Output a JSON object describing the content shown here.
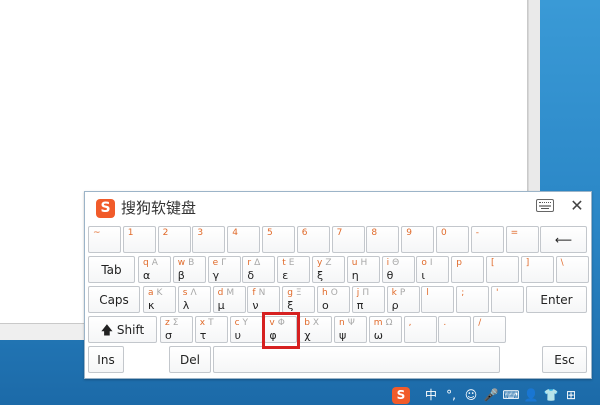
{
  "window": {
    "title": "搜狗软键盘",
    "logo_letter": "S"
  },
  "rows": [
    [
      {
        "top": "~",
        "up": "",
        "main": ""
      },
      {
        "top": "1",
        "up": "",
        "main": ""
      },
      {
        "top": "2",
        "up": "",
        "main": ""
      },
      {
        "top": "3",
        "up": "",
        "main": ""
      },
      {
        "top": "4",
        "up": "",
        "main": ""
      },
      {
        "top": "5",
        "up": "",
        "main": ""
      },
      {
        "top": "6",
        "up": "",
        "main": ""
      },
      {
        "top": "7",
        "up": "",
        "main": ""
      },
      {
        "top": "8",
        "up": "",
        "main": ""
      },
      {
        "top": "9",
        "up": "",
        "main": ""
      },
      {
        "top": "0",
        "up": "",
        "main": ""
      },
      {
        "top": "-",
        "up": "",
        "main": ""
      },
      {
        "top": "=",
        "up": "",
        "main": ""
      }
    ],
    [
      {
        "top": "q",
        "up": "A",
        "main": "α"
      },
      {
        "top": "w",
        "up": "B",
        "main": "β"
      },
      {
        "top": "e",
        "up": "Γ",
        "main": "γ"
      },
      {
        "top": "r",
        "up": "Δ",
        "main": "δ"
      },
      {
        "top": "t",
        "up": "E",
        "main": "ε"
      },
      {
        "top": "y",
        "up": "Z",
        "main": "ξ"
      },
      {
        "top": "u",
        "up": "H",
        "main": "η"
      },
      {
        "top": "i",
        "up": "Θ",
        "main": "θ"
      },
      {
        "top": "o",
        "up": "I",
        "main": "ι"
      },
      {
        "top": "p",
        "up": "",
        "main": ""
      },
      {
        "top": "[",
        "up": "",
        "main": ""
      },
      {
        "top": "]",
        "up": "",
        "main": ""
      },
      {
        "top": "\\",
        "up": "",
        "main": ""
      }
    ],
    [
      {
        "top": "a",
        "up": "K",
        "main": "κ"
      },
      {
        "top": "s",
        "up": "Λ",
        "main": "λ"
      },
      {
        "top": "d",
        "up": "M",
        "main": "μ"
      },
      {
        "top": "f",
        "up": "N",
        "main": "ν"
      },
      {
        "top": "g",
        "up": "Ξ",
        "main": "ξ"
      },
      {
        "top": "h",
        "up": "O",
        "main": "ο"
      },
      {
        "top": "j",
        "up": "Π",
        "main": "π"
      },
      {
        "top": "k",
        "up": "P",
        "main": "ρ"
      },
      {
        "top": "l",
        "up": "",
        "main": ""
      },
      {
        "top": ";",
        "up": "",
        "main": ""
      },
      {
        "top": "'",
        "up": "",
        "main": ""
      }
    ],
    [
      {
        "top": "z",
        "up": "Σ",
        "main": "σ"
      },
      {
        "top": "x",
        "up": "T",
        "main": "τ"
      },
      {
        "top": "c",
        "up": "Y",
        "main": "υ"
      },
      {
        "top": "v",
        "up": "Φ",
        "main": "φ"
      },
      {
        "top": "b",
        "up": "X",
        "main": "χ"
      },
      {
        "top": "n",
        "up": "Ψ",
        "main": "ψ"
      },
      {
        "top": "m",
        "up": "Ω",
        "main": "ω"
      },
      {
        "top": ",",
        "up": "",
        "main": ""
      },
      {
        "top": ".",
        "up": "",
        "main": ""
      },
      {
        "top": "/",
        "up": "",
        "main": ""
      }
    ]
  ],
  "special": {
    "backspace": "⟵",
    "tab": "Tab",
    "caps": "Caps",
    "enter": "Enter",
    "shift": "🡅 Shift",
    "ins": "Ins",
    "del": "Del",
    "esc": "Esc"
  },
  "tray": [
    "S",
    "中",
    "°,",
    "☺",
    "🎤",
    "⌨",
    "👤",
    "👕",
    "⊞"
  ],
  "highlighted_key": "v"
}
